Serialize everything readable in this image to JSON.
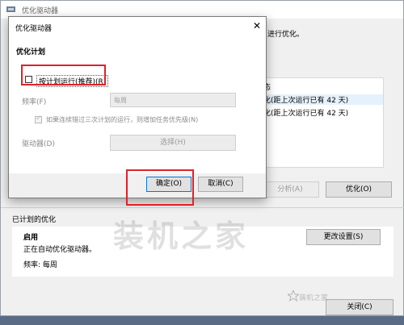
{
  "parent": {
    "title": "优化驱动器",
    "intro": "进行优化。",
    "list_header": "态",
    "list_rows": [
      "化(距上次运行已有 42 天)",
      "化(距上次运行已有 42 天)"
    ],
    "analyze_btn": "分析(A)",
    "optimize_btn": "优化(O)",
    "scheduled_title": "已计划的优化",
    "sched_status": "启用",
    "sched_desc": "正在自动优化驱动器。",
    "sched_freq": "频率: 每周",
    "change_settings_btn": "更改设置(S)",
    "close_btn": "关闭(C)"
  },
  "dialog": {
    "title": "优化驱动器",
    "section_title": "优化计划",
    "run_on_schedule": "按计划运行(推荐)(R)",
    "frequency_label": "频率(F)",
    "frequency_value": "每周",
    "increase_priority": "如果连续错过三次计划的运行，则增加任务优先级(N)",
    "drives_label": "驱动器(D)",
    "choose_btn": "选择(H)",
    "ok_btn": "确定(O)",
    "cancel_btn": "取消(C)"
  },
  "watermark": "装机之家",
  "logo_text": "装机之家",
  "colors": {
    "highlight": "#e0212a",
    "selection": "#e5f1fb"
  }
}
